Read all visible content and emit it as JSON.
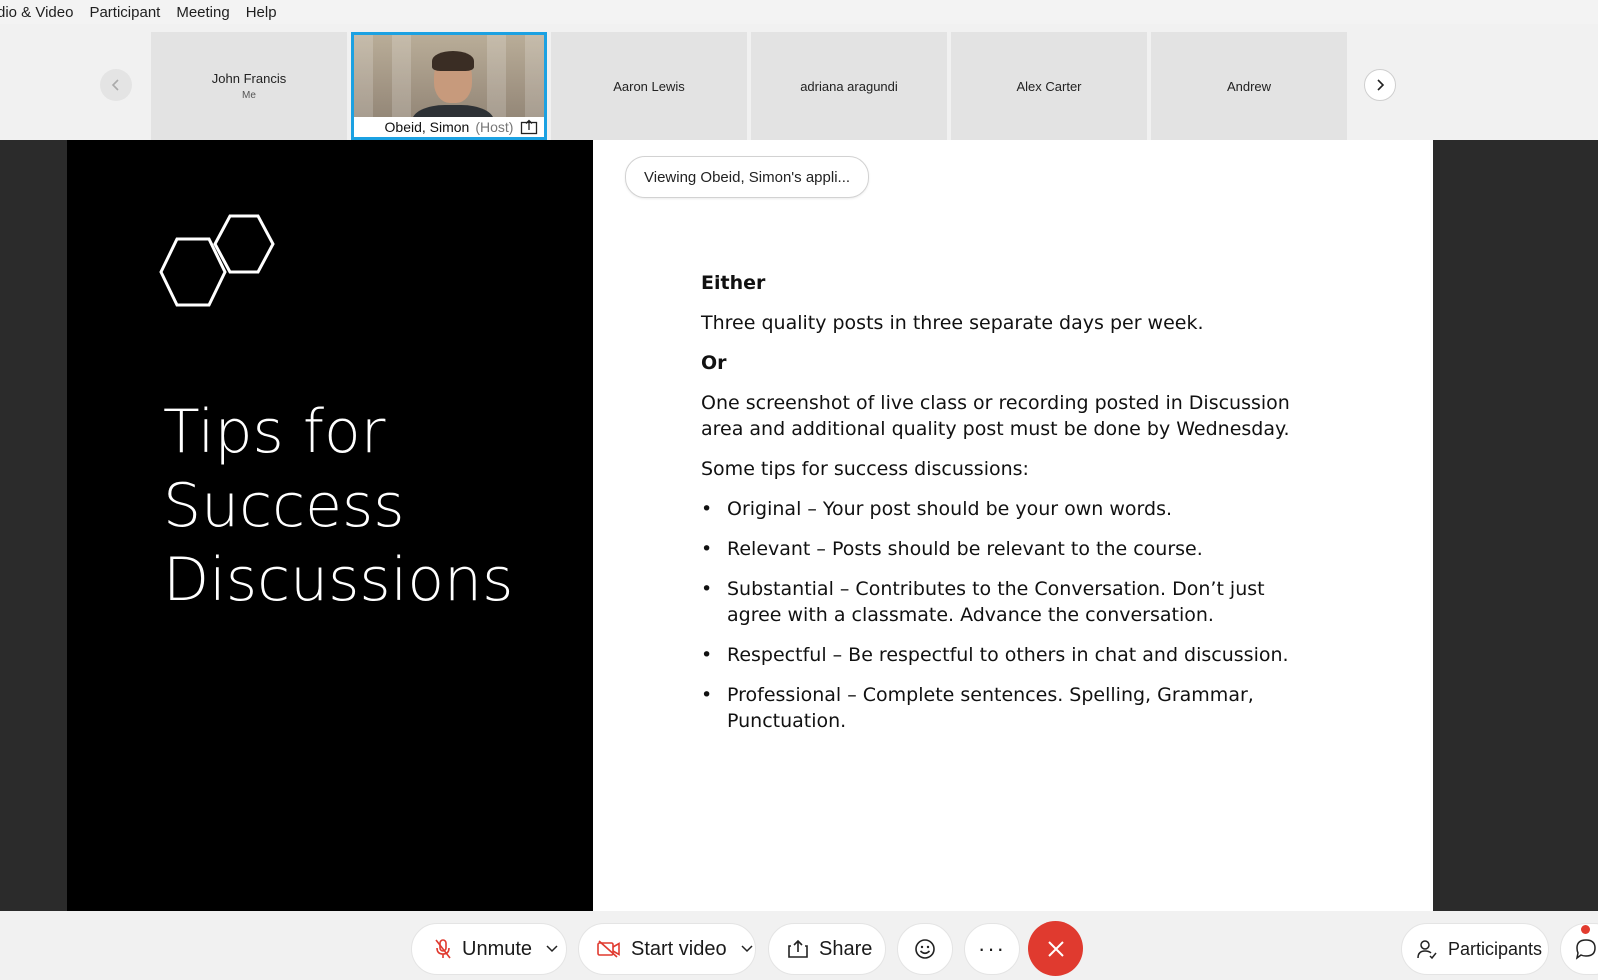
{
  "menu": {
    "items": [
      "dio & Video",
      "Participant",
      "Meeting",
      "Help"
    ]
  },
  "participants": {
    "tiles": [
      {
        "name": "John Francis",
        "sub": "Me"
      },
      {
        "name": "Obeid, Simon",
        "role": "(Host)"
      },
      {
        "name": "Aaron Lewis"
      },
      {
        "name": "adriana aragundi"
      },
      {
        "name": "Alex Carter"
      },
      {
        "name": "Andrew"
      }
    ]
  },
  "stage": {
    "viewing_label": "Viewing Obeid, Simon's appli...",
    "slide": {
      "title_lines": [
        "Tips for",
        "Success",
        "Discussions"
      ],
      "either": "Either",
      "line1": "Three quality posts in three separate days per week.",
      "or": "Or",
      "line2a": "One screenshot of live class or recording posted in Discussion",
      "line2b": "area and additional quality post must be done by Wednesday.",
      "tips_intro": "Some tips for success discussions:",
      "bullet": "•",
      "tips": [
        {
          "a": "Original – Your post should be your own words.",
          "b": ""
        },
        {
          "a": "Relevant – Posts should be relevant to the course.",
          "b": ""
        },
        {
          "a": "Substantial – Contributes to the Conversation. Don’t just",
          "b": "agree with a classmate. Advance the conversation."
        },
        {
          "a": "Respectful – Be respectful to others in chat and discussion.",
          "b": ""
        },
        {
          "a": "Professional – Complete sentences. Spelling, Grammar,",
          "b": "Punctuation."
        }
      ]
    }
  },
  "toolbar": {
    "unmute": "Unmute",
    "start_video": "Start video",
    "share": "Share",
    "more": "···",
    "participants": "Participants"
  },
  "colors": {
    "active_border": "#1ba1e2",
    "end_call": "#e03a2f",
    "mic_icon": "#e03a2f",
    "video_icon": "#e03a2f"
  },
  "icons": [
    "chevron-left-icon",
    "chevron-right-icon",
    "share-screen-icon",
    "microphone-muted-icon",
    "video-off-icon",
    "share-icon",
    "reactions-icon",
    "more-icon",
    "end-call-icon",
    "participants-icon",
    "chat-icon",
    "hexagon-logo-icon"
  ]
}
